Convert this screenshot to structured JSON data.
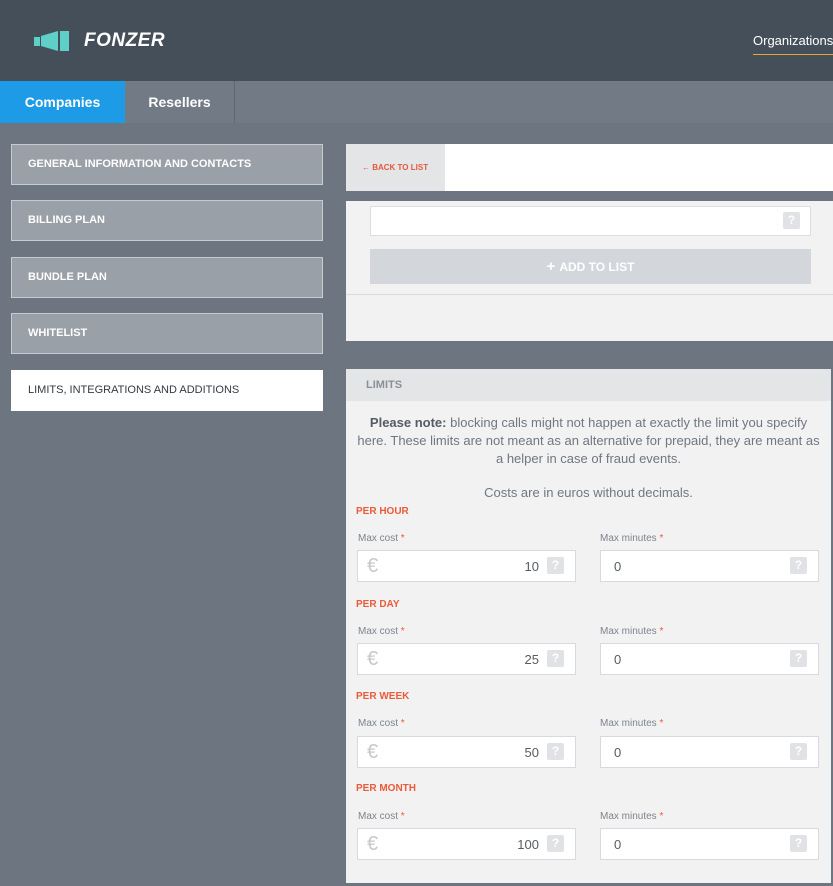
{
  "brand": {
    "name": "FONZER",
    "icon": "megaphone-logo-icon",
    "accent": "#e4a935"
  },
  "header": {
    "nav_link": "Organizations"
  },
  "tabs": [
    {
      "label": "Companies",
      "active": true
    },
    {
      "label": "Resellers",
      "active": false
    }
  ],
  "sidebar": {
    "items": [
      {
        "label": "GENERAL INFORMATION AND CONTACTS",
        "active": false
      },
      {
        "label": "BILLING PLAN",
        "active": false
      },
      {
        "label": "BUNDLE PLAN",
        "active": false
      },
      {
        "label": "WHITELIST",
        "active": false
      },
      {
        "label": "LIMITS, INTEGRATIONS AND ADDITIONS",
        "active": true
      }
    ]
  },
  "toolbar": {
    "back_label": "← BACK TO LIST"
  },
  "whitelist": {
    "input_value": "",
    "add_label": "ADD TO LIST",
    "help_glyph": "?"
  },
  "limits": {
    "title": "LIMITS",
    "note_bold": "Please note:",
    "note_text": " blocking calls might not happen at exactly the limit you specify here. These limits are not meant as an alternative for prepaid, they are meant as a helper in case of fraud events.",
    "costs_note": "Costs are in euros without decimals.",
    "cost_label": "Max cost",
    "minutes_label": "Max minutes",
    "required_mark": "*",
    "currency_symbol": "€",
    "periods": [
      {
        "label": "PER HOUR",
        "max_cost": "10",
        "max_minutes": "0"
      },
      {
        "label": "PER DAY",
        "max_cost": "25",
        "max_minutes": "0"
      },
      {
        "label": "PER WEEK",
        "max_cost": "50",
        "max_minutes": "0"
      },
      {
        "label": "PER MONTH",
        "max_cost": "100",
        "max_minutes": "0"
      }
    ]
  },
  "colors": {
    "primary_tab": "#1e9be7",
    "required": "#ea5b3a",
    "header_bg": "#444f5a"
  }
}
